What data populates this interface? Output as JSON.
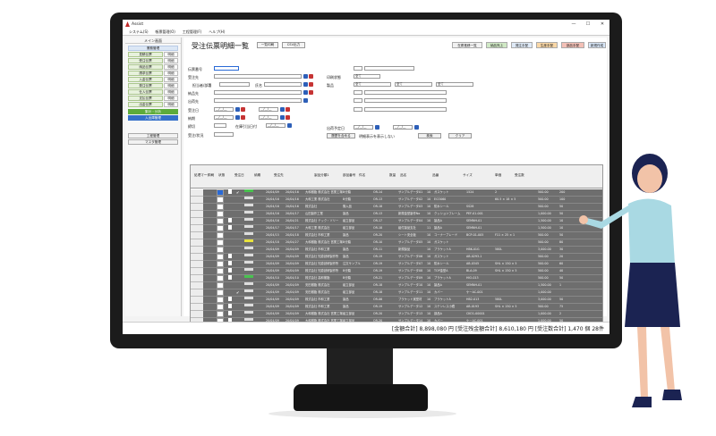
{
  "window": {
    "title": "Assist",
    "minimize": "—",
    "maximize": "☐",
    "close": "✕"
  },
  "menu": [
    "システム(S)",
    "帳票管理(O)",
    "工程管理(F)",
    "ヘルプ(H)"
  ],
  "sidebar": {
    "title": "メイン画面",
    "section_label": "業務管理",
    "rows": [
      {
        "main": "見積伝票",
        "sub": "明細"
      },
      {
        "main": "受注伝票",
        "sub": "明細"
      },
      {
        "main": "納品伝票",
        "sub": "明細"
      },
      {
        "main": "請求伝票",
        "sub": "明細"
      },
      {
        "main": "入金伝票",
        "sub": "明細"
      },
      {
        "main": "発注伝票",
        "sub": "明細"
      },
      {
        "main": "仕入伝票",
        "sub": "明細"
      },
      {
        "main": "支払伝票",
        "sub": "明細"
      },
      {
        "main": "出金伝票",
        "sub": "明細"
      }
    ],
    "green_button": "集計・分析",
    "blue_button": "入出庫管理",
    "process_button": "工程管理",
    "master_button": "マスタ管理"
  },
  "main": {
    "title": "受注伝票明細一覧",
    "toolbar": [
      "一覧印刷",
      "CSV出力"
    ],
    "color_buttons": [
      {
        "label": "在庫推移一覧",
        "bg": "#f1f1f1"
      },
      {
        "label": "納品売上",
        "bg": "#cfe8c4"
      },
      {
        "label": "発注手配",
        "bg": "#dfeaf7"
      },
      {
        "label": "生産手配",
        "bg": "#f9d7a6"
      },
      {
        "label": "部品手配",
        "bg": "#f3c0b6"
      },
      {
        "label": "新規作成",
        "bg": "#d8e6f7"
      }
    ],
    "filters": {
      "order_no": "伝票番号",
      "customer": "受注先",
      "person": "担当者/部署",
      "name": "氏名",
      "delivery": "納品先",
      "shipping": "出荷先",
      "order_date": "受注日",
      "due_date": "納期",
      "deadline": "締切",
      "inspection": "受注/状況",
      "fixed_label": "在庫引当日付",
      "sort_state": "印刷状態",
      "product": "製品",
      "all_opt": "全て",
      "ship_date": "出荷予定日",
      "hide_check": "明細表示を表示しない",
      "date_placeholder": "__/__/__",
      "search_btn": "検索",
      "clear_btn": "クリア",
      "condition_btn": "履歴を含める"
    },
    "columns": [
      "処理マーク",
      "印刷",
      "状態",
      "受注日",
      "納期",
      "受注先",
      "製品分類1",
      "部品番号",
      "件名",
      "数量",
      "品名",
      "品番",
      "サイズ",
      "単価",
      "受注数"
    ],
    "rows": [
      {
        "doc": true,
        "check": true,
        "state": "green",
        "order": "20/04/09",
        "due": "20/04/16",
        "customer": "大和樹脂 株式会社 営業工場",
        "cat": "B分類",
        "code": "OR-14",
        "subject": "サンプルデータ01",
        "qty": "10",
        "item": "ガスケット",
        "part": "1524",
        "size": "2",
        "price": "500.00",
        "count": "200",
        "sel": "blue"
      },
      {
        "doc": false,
        "check": false,
        "state": "grey",
        "order": "20/04/16",
        "due": "20/04/16",
        "customer": "大和工業 株式会社",
        "cat": "B分類",
        "code": "OR-13",
        "subject": "サンプルデータ02",
        "qty": "10",
        "item": "ECO060",
        "part": "",
        "size": "60.5 × 18 × 5",
        "price": "500.00",
        "count": "100",
        "sel": "white"
      },
      {
        "doc": false,
        "check": false,
        "state": "grey",
        "order": "20/04/16",
        "due": "20/04/16",
        "customer": "株式会社",
        "cat": "購入品",
        "code": "OR-18",
        "subject": "サンプルデータ03",
        "qty": "10",
        "item": "防水シール",
        "part": "SS28",
        "size": "",
        "price": "500.00",
        "count": "50",
        "sel": "white"
      },
      {
        "doc": false,
        "check": false,
        "state": "grey",
        "order": "20/04/16",
        "due": "20/04/17",
        "customer": "山田製作工業",
        "cat": "製品",
        "code": "OR-13",
        "subject": "新規金型製作No",
        "qty": "10",
        "item": "クッションフレーム",
        "part": "PEF-01-001",
        "size": "",
        "price": "1,000.00",
        "count": "50",
        "sel": "white"
      },
      {
        "doc": true,
        "check": false,
        "state": "grey",
        "order": "20/04/16",
        "due": "20/04/21",
        "customer": "株式会社 テック・ソリー",
        "cat": "組立部品",
        "code": "OR-17",
        "subject": "サンプルデータ04",
        "qty": "10",
        "item": "製品A",
        "part": "SEMNH-01",
        "size": "",
        "price": "1,500.00",
        "count": "10",
        "sel": "white"
      },
      {
        "doc": true,
        "check": false,
        "state": "grey",
        "order": "20/04/17",
        "due": "20/04/17",
        "customer": "大和工業 株式会社",
        "cat": "組立部品",
        "code": "OR-18",
        "subject": "組付製品支社",
        "qty": "11",
        "item": "製品A",
        "part": "SEMNH-01",
        "size": "",
        "price": "1,500.00",
        "count": "10",
        "sel": "white"
      },
      {
        "doc": false,
        "check": false,
        "state": "grey",
        "order": "20/04/15",
        "due": "20/04/18",
        "customer": "株式会社 市和工業",
        "cat": "製品",
        "code": "OR-20",
        "subject": "シート安全板",
        "qty": "10",
        "item": "コーナーブレード",
        "part": "BCP-01-005",
        "size": "F11 × 25 × 1",
        "price": "500.00",
        "count": "50",
        "sel": "white"
      },
      {
        "doc": false,
        "check": false,
        "state": "yellow",
        "order": "20/04/18",
        "due": "20/04/27",
        "customer": "大和樹脂 株式会社 営業工場",
        "cat": "B分類",
        "code": "OR-10",
        "subject": "サンプルデータ05",
        "qty": "10",
        "item": "ガスケット",
        "part": "",
        "size": "",
        "price": "500.00",
        "count": "80",
        "sel": "white"
      },
      {
        "doc": false,
        "check": false,
        "state": "grey",
        "order": "20/04/09",
        "due": "20/04/09",
        "customer": "株式会社 市和工業",
        "cat": "製品",
        "code": "OR-11",
        "subject": "新規製品",
        "qty": "10",
        "item": "ブラケットA",
        "part": "HBK-01G",
        "size": "580L",
        "price": "3,000.00",
        "count": "30",
        "sel": "white"
      },
      {
        "doc": true,
        "check": false,
        "state": "grey",
        "order": "20/04/09",
        "due": "20/04/09",
        "customer": "株式会社 知恵創研製作所",
        "cat": "製品",
        "code": "OR-19",
        "subject": "サンプルデータ06",
        "qty": "10",
        "item": "ガスケット",
        "part": "AB-0293-1",
        "size": "",
        "price": "500.00",
        "count": "20",
        "sel": "white"
      },
      {
        "doc": true,
        "check": false,
        "state": "grey",
        "order": "20/04/09",
        "due": "20/04/09",
        "customer": "株式会社 知恵創研製作所",
        "cat": "注文サンプル",
        "code": "OR-19",
        "subject": "サンプルデータ07",
        "qty": "10",
        "item": "防水シール",
        "part": "AB-0345",
        "size": "SHL × 150 × 5",
        "price": "500.00",
        "count": "60",
        "sel": "white"
      },
      {
        "doc": true,
        "check": false,
        "state": "grey",
        "order": "20/04/09",
        "due": "20/04/09",
        "customer": "株式会社 知恵創研製作所",
        "cat": "B分類",
        "code": "OR-19",
        "subject": "サンプルデータ08",
        "qty": "10",
        "item": "TOP金型A",
        "part": "BLA-09",
        "size": "SHL × 150 × 5",
        "price": "500.00",
        "count": "40",
        "sel": "white"
      },
      {
        "doc": true,
        "check": false,
        "state": "green",
        "order": "20/04/10",
        "due": "20/04/10",
        "customer": "株式会社 高和樹脂",
        "cat": "B分類",
        "code": "OR-21",
        "subject": "サンプルデータ09",
        "qty": "10",
        "item": "ブラケットA",
        "part": "HIO-013",
        "size": "",
        "price": "500.00",
        "count": "50",
        "sel": "white"
      },
      {
        "doc": false,
        "check": false,
        "state": "grey",
        "order": "20/04/09",
        "due": "20/04/09",
        "customer": "安田樹脂 株式会社",
        "cat": "組立部品",
        "code": "OR-18",
        "subject": "サンプルデータ10",
        "qty": "10",
        "item": "製品A",
        "part": "SEMNH-01",
        "size": "",
        "price": "1,500.00",
        "count": "1",
        "sel": "white"
      },
      {
        "doc": false,
        "check": true,
        "state": "grey",
        "order": "20/04/09",
        "due": "20/04/09",
        "customer": "安田樹脂 株式会社",
        "cat": "組立部品",
        "code": "OR-18",
        "subject": "サンプルデータ11",
        "qty": "10",
        "item": "カバー",
        "part": "ケーAC-001",
        "size": "",
        "price": "1,000.00",
        "count": "",
        "sel": "white"
      },
      {
        "doc": true,
        "check": false,
        "state": "grey",
        "order": "20/04/09",
        "due": "20/04/09",
        "customer": "株式会社 市和工業",
        "cat": "製品",
        "code": "OR-06",
        "subject": "ブラケット実型材",
        "qty": "10",
        "item": "ブラケットA",
        "part": "HB2-013",
        "size": "580L",
        "price": "3,000.00",
        "count": "50",
        "sel": "white"
      },
      {
        "doc": true,
        "check": false,
        "state": "grey",
        "order": "20/04/09",
        "due": "20/04/09",
        "customer": "株式会社 市和工業",
        "cat": "製品",
        "code": "OR-19",
        "subject": "サンプルデータ12",
        "qty": "10",
        "item": "ステンレス小鐵",
        "part": "AB-0193",
        "size": "SHL × 150 × 5",
        "price": "500.00",
        "count": "75",
        "sel": "white"
      },
      {
        "doc": true,
        "check": false,
        "state": "grey",
        "order": "20/04/09",
        "due": "20/04/09",
        "customer": "大和樹脂 株式会社 営業工場",
        "cat": "組立部品",
        "code": "OR-20",
        "subject": "サンプルデータ13",
        "qty": "10",
        "item": "部品A",
        "part": "CKO1-00001",
        "size": "",
        "price": "1,000.00",
        "count": "2",
        "sel": "white"
      },
      {
        "doc": true,
        "check": false,
        "state": "grey",
        "order": "20/04/09",
        "due": "20/04/09",
        "customer": "大和樹脂 株式会社 営業工場",
        "cat": "組立部品",
        "code": "OR-20",
        "subject": "サンプルデータ14",
        "qty": "10",
        "item": "カバー",
        "part": "ケーAC-001",
        "size": "",
        "price": "1,000.00",
        "count": "50",
        "sel": "white"
      }
    ],
    "footer": "[金額合計] 8,898,080 円 [受注残金額合計] 8,610,180 円 [受注数合計] 1,470 個 28件"
  },
  "colors": {
    "bezel": "#1b1b1b",
    "row_grey": "#6e6e6e",
    "accent_blue": "#2a6ad6",
    "green": "#5dab3b"
  }
}
